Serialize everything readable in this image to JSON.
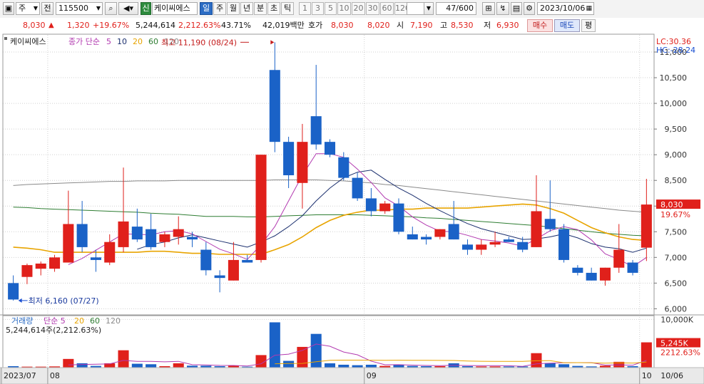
{
  "toolbar": {
    "market_type": "주",
    "prev_label": "전",
    "code": "115500",
    "new_badge": "신",
    "stock_name": "케이씨에스",
    "periods": [
      "일",
      "주",
      "월",
      "년",
      "분",
      "초",
      "틱"
    ],
    "active_period": "일",
    "intervals": [
      "1",
      "3",
      "5",
      "10",
      "20",
      "30",
      "60",
      "120"
    ],
    "count": "47",
    "count_total": "/600",
    "date": "2023/10/06"
  },
  "quote": {
    "price": "8,030",
    "change_arrow": "▲",
    "change": "1,320",
    "change_pct": "+19.67%",
    "volume": "5,244,614",
    "volume_pct": "2,212.63%",
    "turnover_pct": "43.71%",
    "amount": "42,019백만",
    "hoga_label": "호가",
    "ask": "8,030",
    "bid": "8,020",
    "open_label": "시",
    "open": "7,190",
    "high_label": "고",
    "high": "8,530",
    "low_label": "저",
    "low": "6,930",
    "buy_label": "매수",
    "sell_label": "매도",
    "avg_label": "평"
  },
  "colors": {
    "up": "#e0201b",
    "down": "#1a62c7",
    "ma5": "#b23ab0",
    "ma10": "#1b2f6e",
    "ma20": "#e8a400",
    "ma60": "#2e7d32",
    "ma120": "#8a8a8a"
  },
  "chart_data": {
    "type": "candlestick",
    "title": "케이씨에스",
    "legend": {
      "price_label": "종가 단순",
      "ma_periods": [
        "5",
        "10",
        "20",
        "60",
        "120"
      ],
      "volume_label": "거래량",
      "vol_simple": "단순 5",
      "vol_periods": [
        "20",
        "60",
        "120"
      ],
      "volume_summary": "5,244,614주(2,212.63%)"
    },
    "lc_label": "LC:30.36",
    "hc_label": "HC:-28.24",
    "max_annotation": "최고 11,190 (08/24)",
    "min_annotation": "최저 6,160 (07/27)",
    "y_ticks": [
      "11,000",
      "10,500",
      "10,000",
      "9,500",
      "9,000",
      "8,500",
      "8,000",
      "7,500",
      "7,000",
      "6,500",
      "6,000"
    ],
    "y_tick_values": [
      11000,
      10500,
      10000,
      9500,
      9000,
      8500,
      8000,
      7500,
      7000,
      6500,
      6000
    ],
    "ylim": [
      5950,
      11250
    ],
    "price_tag": "8,030",
    "price_tag_pct": "19.67%",
    "volume_ticks": [
      "10,000K"
    ],
    "volume_tick_values": [
      10000
    ],
    "volume_ylim": [
      0,
      10500
    ],
    "volume_tag": "5,245K",
    "volume_tag_pct": "2212.63%",
    "x_labels": [
      {
        "text": "2023/07",
        "index": 0
      },
      {
        "text": "08",
        "index": 3
      },
      {
        "text": "09",
        "index": 26
      },
      {
        "text": "10",
        "index": 46
      }
    ],
    "x_right_label": "10/06",
    "candles": [
      {
        "o": 6500,
        "h": 6650,
        "l": 6160,
        "c": 6180,
        "v": 300
      },
      {
        "o": 6620,
        "h": 6880,
        "l": 6480,
        "c": 6850,
        "v": 200
      },
      {
        "o": 6780,
        "h": 6920,
        "l": 6650,
        "c": 6880,
        "v": 200
      },
      {
        "o": 6780,
        "h": 7050,
        "l": 6720,
        "c": 7000,
        "v": 250
      },
      {
        "o": 6900,
        "h": 8300,
        "l": 6900,
        "c": 7650,
        "v": 1800
      },
      {
        "o": 7650,
        "h": 8100,
        "l": 7100,
        "c": 7200,
        "v": 900
      },
      {
        "o": 7000,
        "h": 7150,
        "l": 6720,
        "c": 6950,
        "v": 350
      },
      {
        "o": 6900,
        "h": 7450,
        "l": 6850,
        "c": 7300,
        "v": 900
      },
      {
        "o": 7200,
        "h": 8750,
        "l": 7100,
        "c": 7700,
        "v": 3600
      },
      {
        "o": 7600,
        "h": 7950,
        "l": 7300,
        "c": 7350,
        "v": 800
      },
      {
        "o": 7550,
        "h": 7850,
        "l": 7150,
        "c": 7200,
        "v": 700
      },
      {
        "o": 7300,
        "h": 7500,
        "l": 7200,
        "c": 7450,
        "v": 300
      },
      {
        "o": 7400,
        "h": 7800,
        "l": 7250,
        "c": 7550,
        "v": 900
      },
      {
        "o": 7400,
        "h": 7500,
        "l": 7200,
        "c": 7350,
        "v": 400
      },
      {
        "o": 7150,
        "h": 7300,
        "l": 6650,
        "c": 6750,
        "v": 400
      },
      {
        "o": 6650,
        "h": 6750,
        "l": 6320,
        "c": 6600,
        "v": 300
      },
      {
        "o": 6550,
        "h": 7300,
        "l": 6550,
        "c": 6950,
        "v": 400
      },
      {
        "o": 6950,
        "h": 7050,
        "l": 6900,
        "c": 6900,
        "v": 200
      },
      {
        "o": 6950,
        "h": 9000,
        "l": 6900,
        "c": 9000,
        "v": 2600
      },
      {
        "o": 10650,
        "h": 11190,
        "l": 9050,
        "c": 9250,
        "v": 9400
      },
      {
        "o": 9250,
        "h": 9350,
        "l": 8350,
        "c": 8600,
        "v": 1400
      },
      {
        "o": 8450,
        "h": 9600,
        "l": 7950,
        "c": 9250,
        "v": 4300
      },
      {
        "o": 9750,
        "h": 10750,
        "l": 9100,
        "c": 9200,
        "v": 7000
      },
      {
        "o": 9250,
        "h": 9300,
        "l": 8950,
        "c": 9000,
        "v": 900
      },
      {
        "o": 8950,
        "h": 9050,
        "l": 8500,
        "c": 8550,
        "v": 600
      },
      {
        "o": 8550,
        "h": 8650,
        "l": 8100,
        "c": 8150,
        "v": 500
      },
      {
        "o": 8150,
        "h": 8350,
        "l": 7800,
        "c": 7900,
        "v": 600
      },
      {
        "o": 7900,
        "h": 8100,
        "l": 7850,
        "c": 8050,
        "v": 350
      },
      {
        "o": 8050,
        "h": 8150,
        "l": 7450,
        "c": 7500,
        "v": 600
      },
      {
        "o": 7450,
        "h": 7600,
        "l": 7350,
        "c": 7350,
        "v": 350
      },
      {
        "o": 7400,
        "h": 7450,
        "l": 7250,
        "c": 7350,
        "v": 300
      },
      {
        "o": 7400,
        "h": 7550,
        "l": 7350,
        "c": 7550,
        "v": 300
      },
      {
        "o": 7650,
        "h": 8100,
        "l": 7350,
        "c": 7350,
        "v": 900
      },
      {
        "o": 7250,
        "h": 7350,
        "l": 7050,
        "c": 7150,
        "v": 300
      },
      {
        "o": 7150,
        "h": 7350,
        "l": 7050,
        "c": 7250,
        "v": 250
      },
      {
        "o": 7250,
        "h": 7500,
        "l": 7200,
        "c": 7300,
        "v": 250
      },
      {
        "o": 7350,
        "h": 7400,
        "l": 7300,
        "c": 7300,
        "v": 250
      },
      {
        "o": 7300,
        "h": 7400,
        "l": 7100,
        "c": 7150,
        "v": 250
      },
      {
        "o": 7200,
        "h": 8600,
        "l": 7200,
        "c": 7900,
        "v": 3000
      },
      {
        "o": 7750,
        "h": 8500,
        "l": 7500,
        "c": 7550,
        "v": 900
      },
      {
        "o": 7550,
        "h": 7650,
        "l": 6900,
        "c": 6950,
        "v": 700
      },
      {
        "o": 6800,
        "h": 6850,
        "l": 6650,
        "c": 6700,
        "v": 350
      },
      {
        "o": 6700,
        "h": 6800,
        "l": 6550,
        "c": 6550,
        "v": 250
      },
      {
        "o": 6550,
        "h": 6800,
        "l": 6450,
        "c": 6800,
        "v": 400
      },
      {
        "o": 6800,
        "h": 7650,
        "l": 6700,
        "c": 7150,
        "v": 1200
      },
      {
        "o": 6900,
        "h": 6950,
        "l": 6650,
        "c": 6700,
        "v": 300
      },
      {
        "o": 7190,
        "h": 8530,
        "l": 6930,
        "c": 8030,
        "v": 5245
      }
    ],
    "ma": [
      {
        "name": "5",
        "color": "#b23ab0",
        "values": [
          null,
          null,
          null,
          null,
          6860,
          6980,
          7140,
          7300,
          7460,
          7450,
          7440,
          7500,
          7520,
          7460,
          7310,
          7160,
          7070,
          6960,
          7250,
          7600,
          8100,
          8600,
          9020,
          9020,
          8950,
          8720,
          8460,
          8160,
          8000,
          7790,
          7630,
          7510,
          7500,
          7430,
          7350,
          7320,
          7280,
          7220,
          7360,
          7520,
          7600,
          7540,
          7340,
          7070,
          6960,
          6820,
          7000
        ]
      },
      {
        "name": "10",
        "color": "#1b2f6e",
        "values": [
          null,
          null,
          null,
          null,
          null,
          null,
          null,
          null,
          null,
          7160,
          7250,
          7300,
          7380,
          7440,
          7380,
          7320,
          7260,
          7200,
          7300,
          7420,
          7600,
          7810,
          8100,
          8350,
          8550,
          8660,
          8700,
          8520,
          8350,
          8210,
          8050,
          7910,
          7780,
          7660,
          7560,
          7490,
          7420,
          7350,
          7360,
          7400,
          7460,
          7380,
          7270,
          7200,
          7170,
          7100,
          7180
        ]
      },
      {
        "name": "20",
        "color": "#e8a400",
        "values": [
          7200,
          7180,
          7150,
          7100,
          7100,
          7100,
          7100,
          7100,
          7100,
          7100,
          7120,
          7120,
          7100,
          7080,
          7080,
          7060,
          7060,
          7060,
          7060,
          7150,
          7250,
          7400,
          7580,
          7720,
          7820,
          7880,
          7920,
          7920,
          7940,
          7940,
          7960,
          7960,
          7960,
          7960,
          7980,
          8000,
          8020,
          8040,
          8020,
          7950,
          7860,
          7720,
          7580,
          7480,
          7400,
          7350,
          7330
        ]
      },
      {
        "name": "60",
        "color": "#2e7d32",
        "values": [
          7980,
          7970,
          7950,
          7940,
          7930,
          7920,
          7910,
          7900,
          7890,
          7880,
          7860,
          7850,
          7840,
          7820,
          7800,
          7800,
          7800,
          7790,
          7790,
          7800,
          7810,
          7820,
          7830,
          7830,
          7830,
          7830,
          7820,
          7810,
          7800,
          7790,
          7770,
          7760,
          7740,
          7720,
          7700,
          7680,
          7660,
          7640,
          7620,
          7590,
          7560,
          7530,
          7500,
          7470,
          7450,
          7430,
          7420
        ]
      },
      {
        "name": "120",
        "color": "#8a8a8a",
        "values": [
          8400,
          8420,
          8430,
          8440,
          8450,
          8460,
          8470,
          8480,
          8480,
          8490,
          8490,
          8490,
          8500,
          8500,
          8500,
          8500,
          8500,
          8500,
          8500,
          8510,
          8510,
          8510,
          8510,
          8500,
          8490,
          8470,
          8450,
          8420,
          8400,
          8370,
          8340,
          8310,
          8280,
          8250,
          8220,
          8190,
          8160,
          8130,
          8100,
          8070,
          8040,
          8010,
          7980,
          7950,
          7920,
          7900,
          7880
        ]
      }
    ],
    "vol_ma": [
      {
        "name": "5",
        "color": "#b23ab0",
        "values": [
          null,
          null,
          null,
          null,
          550,
          650,
          700,
          780,
          1500,
          1300,
          1300,
          1200,
          1300,
          600,
          540,
          460,
          440,
          340,
          780,
          2580,
          2800,
          3580,
          4900,
          4440,
          3240,
          2660,
          1340,
          590,
          600,
          520,
          440,
          420,
          490,
          430,
          420,
          400,
          390,
          260,
          790,
          930,
          1020,
          1040,
          1040,
          520,
          580,
          500,
          1500
        ]
      },
      {
        "name": "20",
        "color": "#e8a400",
        "values": [
          null,
          null,
          null,
          null,
          null,
          null,
          null,
          null,
          null,
          null,
          null,
          null,
          null,
          null,
          null,
          null,
          null,
          null,
          null,
          800,
          860,
          870,
          1220,
          1530,
          1560,
          1550,
          1540,
          1520,
          1540,
          1520,
          1530,
          1500,
          1480,
          1380,
          1320,
          1300,
          1300,
          1290,
          1420,
          1450,
          1020,
          1030,
          1010,
          920,
          1000,
          940,
          1170
        ]
      },
      {
        "name": "60",
        "color": "#2e7d32",
        "values": [
          null,
          null,
          null,
          null,
          null,
          null,
          null,
          null,
          null,
          null,
          null,
          null,
          null,
          null,
          null,
          null,
          null,
          null,
          null,
          null,
          null,
          null,
          null,
          null,
          null,
          null,
          null,
          null,
          null,
          null,
          null,
          null,
          null,
          null,
          null,
          null,
          null,
          null,
          null,
          null,
          null,
          null,
          null,
          null,
          null,
          null,
          null
        ]
      }
    ]
  }
}
